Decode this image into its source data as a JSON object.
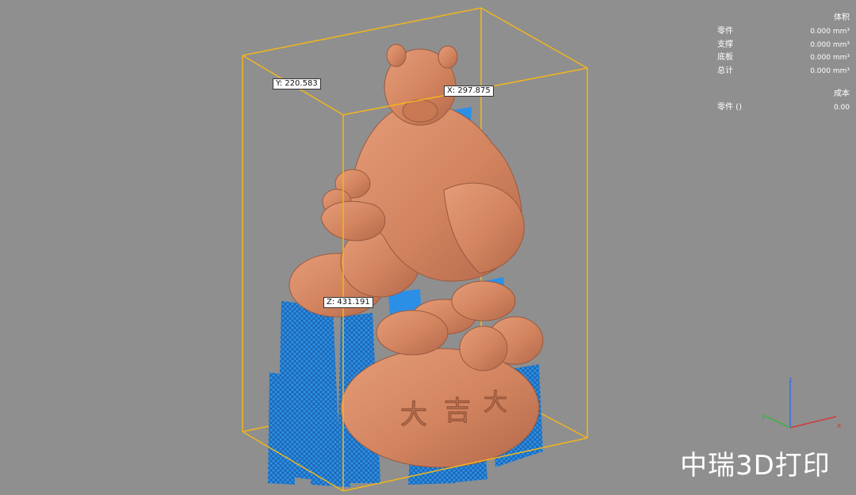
{
  "viewport": {
    "background": "#8f8f8f",
    "model_color": "#d98a68",
    "support_color": "#2c8fe6",
    "bounding_box_color": "#f2b51d"
  },
  "dimensions": {
    "x": "X: 297.875",
    "y": "Y: 220.583",
    "z": "Z: 431.191"
  },
  "stats": {
    "volume_header": "体积",
    "volume_rows": [
      {
        "label": "零件",
        "value": "0.000 mm³"
      },
      {
        "label": "支撑",
        "value": "0.000 mm³"
      },
      {
        "label": "底板",
        "value": "0.000 mm³"
      },
      {
        "label": "总计",
        "value": "0.000 mm³"
      }
    ],
    "cost_header": "成本",
    "cost_rows": [
      {
        "label": "零件 ()",
        "value": "0.00"
      }
    ]
  },
  "axes": {
    "x_label": "x",
    "y_label": "y",
    "z_label": "z",
    "x_color": "#d23a3a",
    "y_color": "#3ab53a",
    "z_color": "#3a6ee0"
  },
  "watermark": "中瑞3D打印"
}
